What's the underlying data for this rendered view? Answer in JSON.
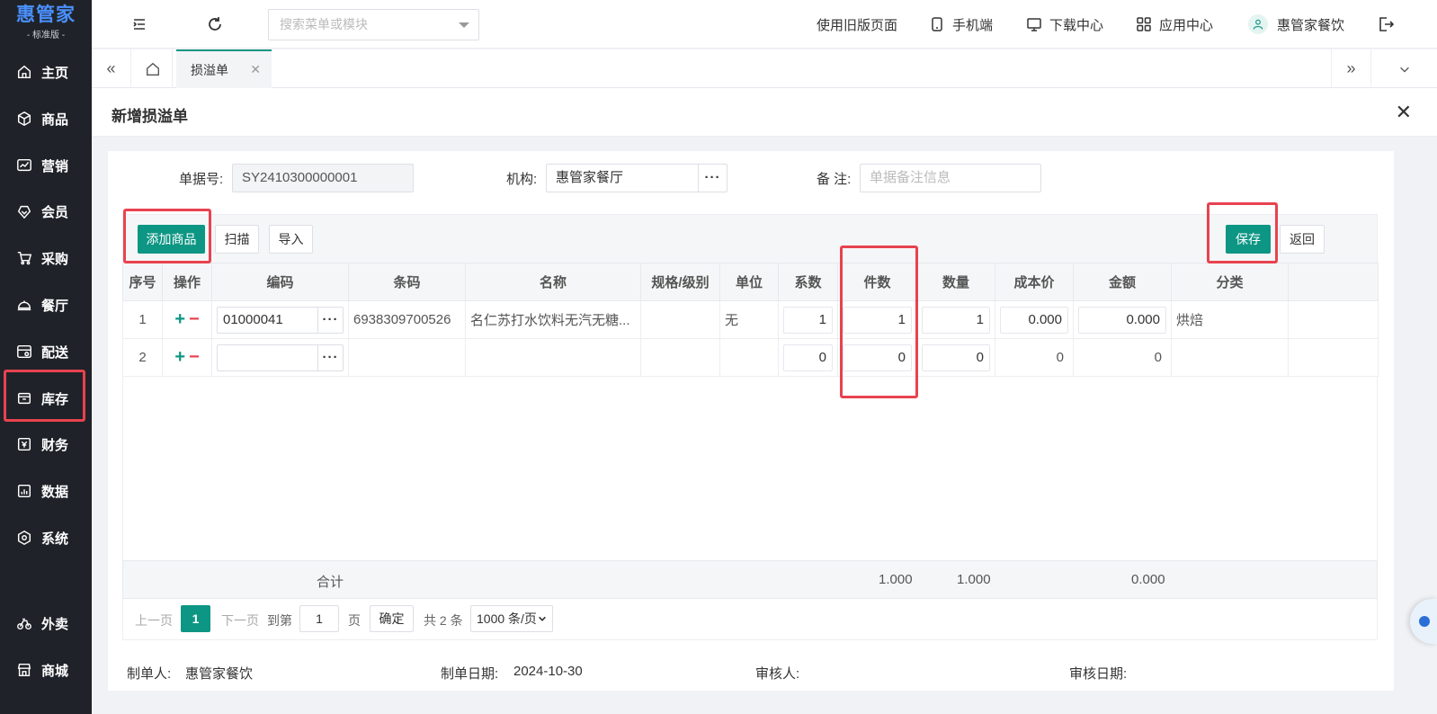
{
  "logo": {
    "main": "惠管家",
    "sub": "- 标准版 -"
  },
  "sidebar": {
    "items": [
      {
        "label": "主页",
        "icon": "home-icon"
      },
      {
        "label": "商品",
        "icon": "cube-icon"
      },
      {
        "label": "营销",
        "icon": "chart-icon"
      },
      {
        "label": "会员",
        "icon": "member-icon"
      },
      {
        "label": "采购",
        "icon": "cart-icon"
      },
      {
        "label": "餐厅",
        "icon": "dish-icon"
      },
      {
        "label": "配送",
        "icon": "delivery-icon"
      },
      {
        "label": "库存",
        "icon": "box-icon"
      },
      {
        "label": "财务",
        "icon": "finance-icon"
      },
      {
        "label": "数据",
        "icon": "data-icon"
      },
      {
        "label": "系统",
        "icon": "settings-icon"
      },
      {
        "label": "外卖",
        "icon": "bike-icon"
      },
      {
        "label": "商城",
        "icon": "store-icon"
      }
    ]
  },
  "topbar": {
    "search_placeholder": "搜索菜单或模块",
    "old_page": "使用旧版页面",
    "mobile": "手机端",
    "download": "下载中心",
    "apps": "应用中心",
    "user": "惠管家餐饮"
  },
  "tabs": {
    "active": "损溢单"
  },
  "page": {
    "title": "新增损溢单"
  },
  "form": {
    "doc_no_label": "单据号:",
    "doc_no_value": "SY2410300000001",
    "org_label": "机构:",
    "org_value": "惠管家餐厅",
    "remark_label": "备 注:",
    "remark_placeholder": "单据备注信息"
  },
  "toolbar": {
    "add": "添加商品",
    "scan": "扫描",
    "import": "导入",
    "save": "保存",
    "back": "返回"
  },
  "table": {
    "headers": [
      "序号",
      "操作",
      "编码",
      "条码",
      "名称",
      "规格/级别",
      "单位",
      "系数",
      "件数",
      "数量",
      "成本价",
      "金额",
      "分类"
    ],
    "rows": [
      {
        "no": "1",
        "code": "01000041",
        "barcode": "6938309700526",
        "name": "名仁苏打水饮料无汽无糖...",
        "spec": "",
        "unit": "无",
        "factor": "1",
        "pieces": "1",
        "qty": "1",
        "cost": "0.000",
        "amount": "0.000",
        "category": "烘焙"
      },
      {
        "no": "2",
        "code": "",
        "barcode": "",
        "name": "",
        "spec": "",
        "unit": "",
        "factor": "0",
        "pieces": "0",
        "qty": "0",
        "cost": "0",
        "amount": "0",
        "category": ""
      }
    ],
    "totals": {
      "label": "合计",
      "pieces": "1.000",
      "qty": "1.000",
      "amount": "0.000"
    }
  },
  "pager": {
    "prev": "上一页",
    "current": "1",
    "next": "下一页",
    "goto": "到第",
    "goto_value": "1",
    "page_unit": "页",
    "confirm": "确定",
    "total": "共 2 条",
    "page_size": "1000 条/页"
  },
  "footer": {
    "maker_label": "制单人:",
    "maker_value": "惠管家餐饮",
    "date_label": "制单日期:",
    "date_value": "2024-10-30",
    "auditor_label": "审核人:",
    "audit_date_label": "审核日期:"
  },
  "colors": {
    "accent": "#0e9684",
    "highlight": "#e8424f",
    "sidebar_bg": "#1f2329",
    "logo": "#4a90ff"
  }
}
